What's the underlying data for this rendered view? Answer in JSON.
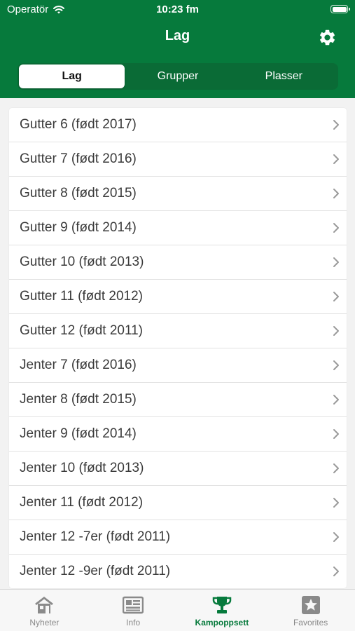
{
  "status_bar": {
    "carrier": "Operatör",
    "time": "10:23 fm"
  },
  "nav": {
    "title": "Lag",
    "settings_icon": "gear-icon"
  },
  "segments": [
    {
      "label": "Lag",
      "selected": true
    },
    {
      "label": "Grupper",
      "selected": false
    },
    {
      "label": "Plasser",
      "selected": false
    }
  ],
  "teams": [
    "Gutter 6 (født 2017)",
    "Gutter 7 (født 2016)",
    "Gutter 8 (født 2015)",
    "Gutter 9 (født 2014)",
    "Gutter 10 (født 2013)",
    "Gutter 11 (født 2012)",
    "Gutter 12 (født 2011)",
    "Jenter 7 (født 2016)",
    "Jenter 8 (født 2015)",
    "Jenter 9 (født 2014)",
    "Jenter 10 (født 2013)",
    "Jenter 11 (født 2012)",
    "Jenter 12 -7er (født 2011)",
    "Jenter 12 -9er (født 2011)"
  ],
  "tabs": [
    {
      "label": "Nyheter",
      "icon": "house-icon",
      "active": false
    },
    {
      "label": "Info",
      "icon": "newspaper-icon",
      "active": false
    },
    {
      "label": "Kampoppsett",
      "icon": "trophy-icon",
      "active": true
    },
    {
      "label": "Favorites",
      "icon": "star-icon",
      "active": false
    }
  ],
  "colors": {
    "brand_green": "#067a3c",
    "tab_inactive": "#8a8a8a"
  }
}
